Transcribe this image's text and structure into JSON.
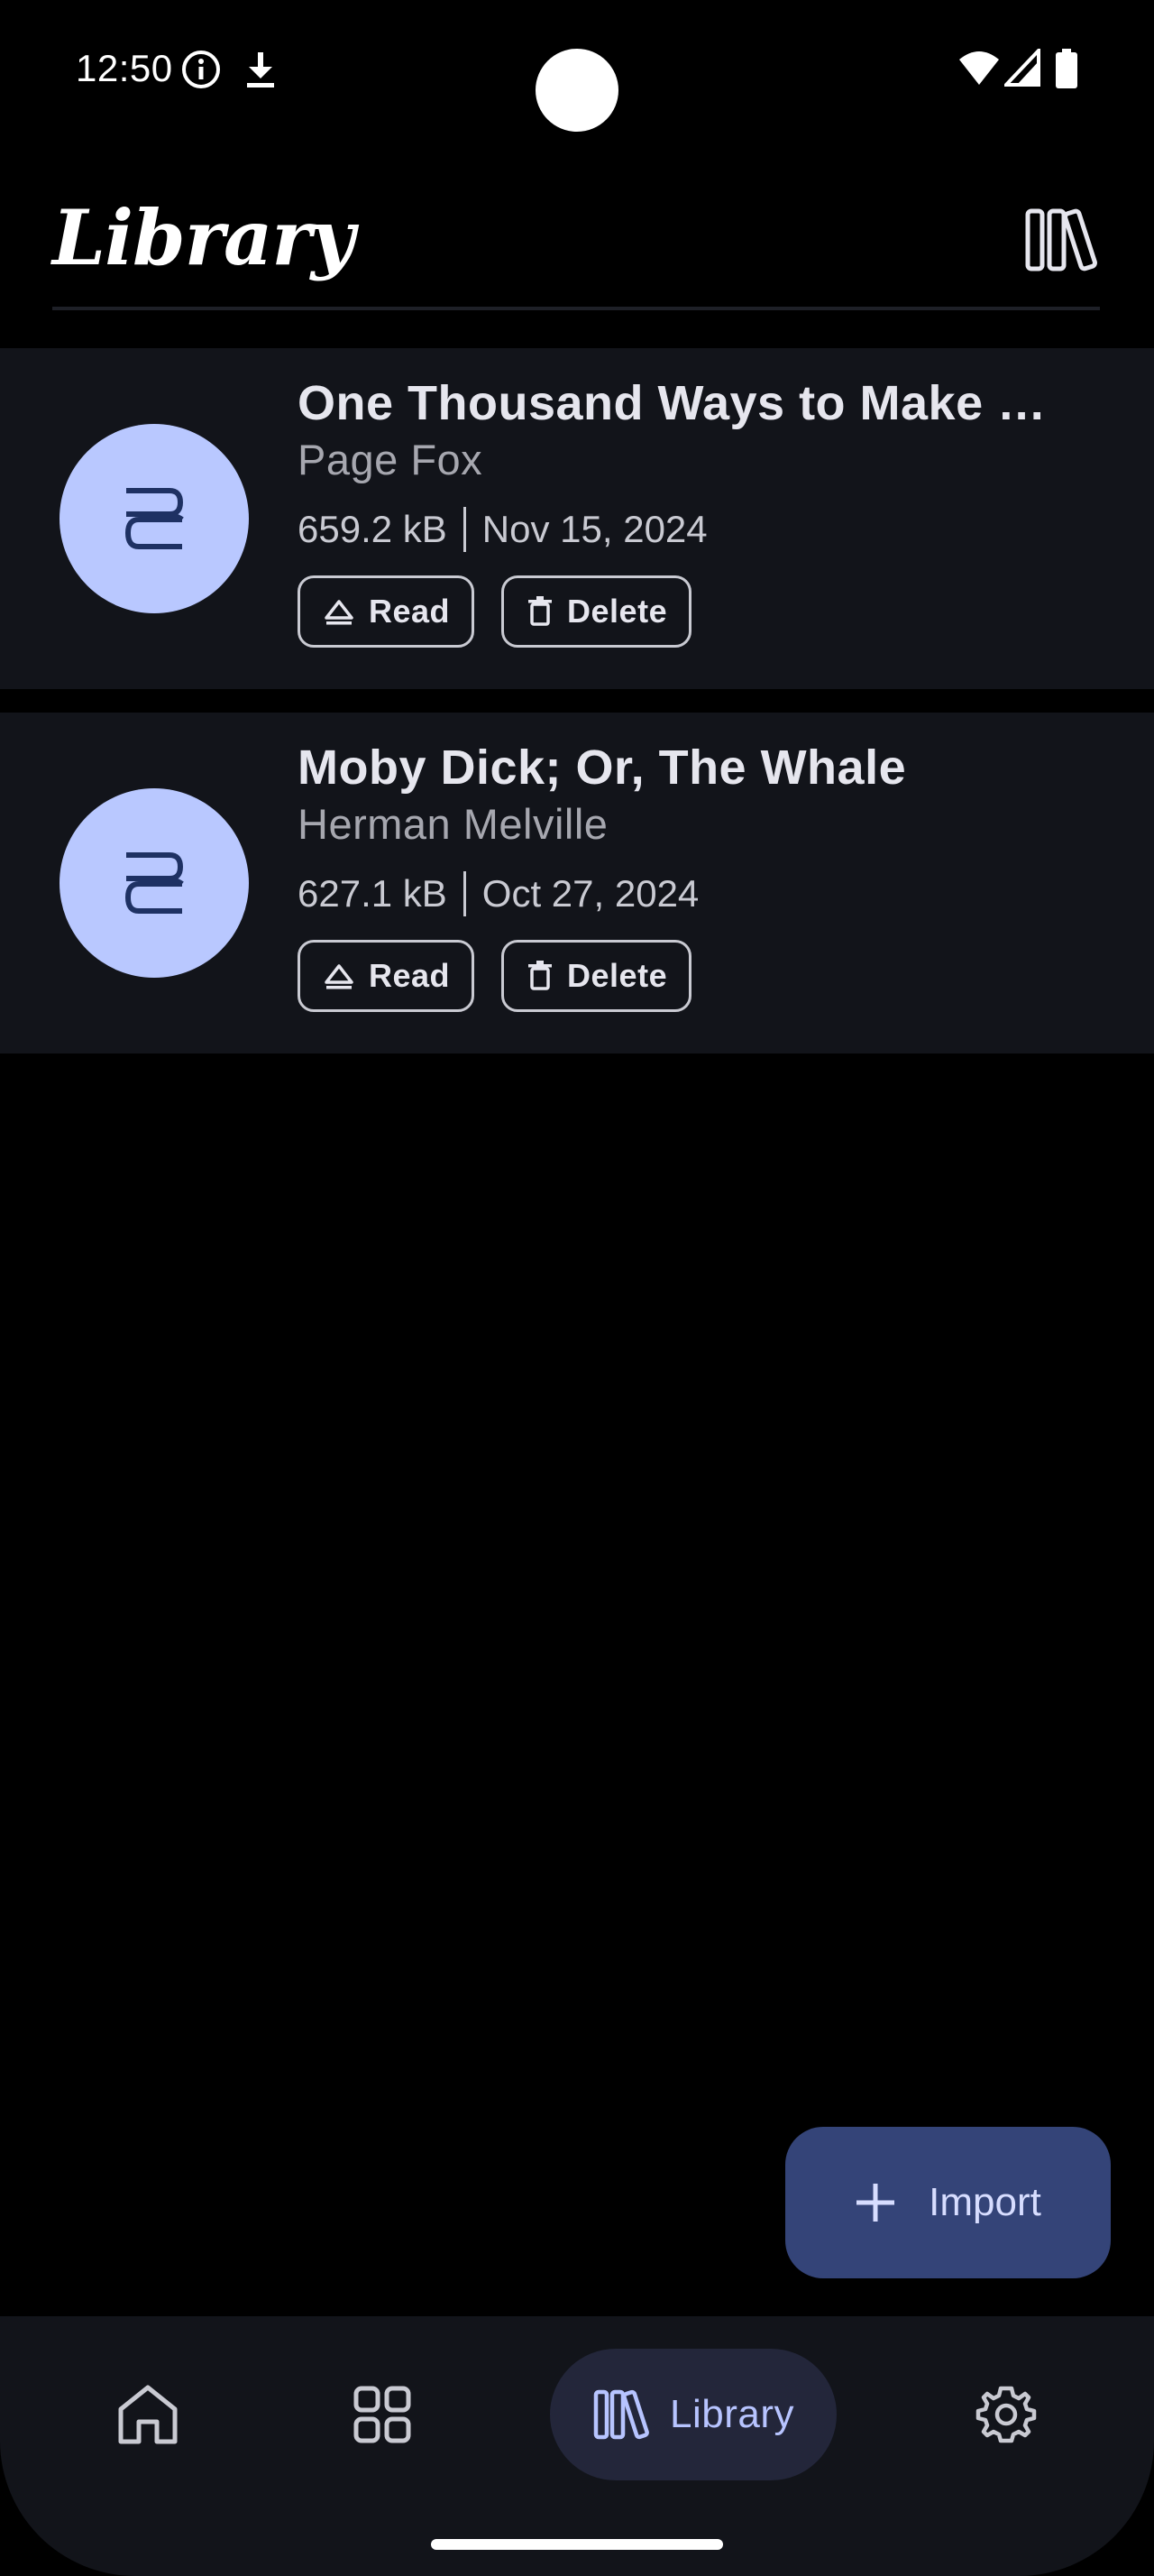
{
  "status_bar": {
    "time": "12:50",
    "icons": [
      "info-icon",
      "download-icon",
      "wifi-icon",
      "signal-icon",
      "battery-icon"
    ]
  },
  "header": {
    "title": "Library",
    "action_icon": "library-books-icon"
  },
  "books": [
    {
      "title": "One Thousand Ways to Make …",
      "author": "Page Fox",
      "size": "659.2 kB",
      "date": "Nov 15, 2024",
      "read_label": "Read",
      "delete_label": "Delete"
    },
    {
      "title": "Moby Dick; Or, The Whale",
      "author": "Herman Melville",
      "size": "627.1 kB",
      "date": "Oct 27, 2024",
      "read_label": "Read",
      "delete_label": "Delete"
    }
  ],
  "fab": {
    "label": "Import",
    "icon": "plus-icon"
  },
  "bottom_nav": {
    "items": [
      {
        "icon": "home-icon",
        "label": ""
      },
      {
        "icon": "grid-icon",
        "label": ""
      },
      {
        "icon": "library-icon",
        "label": "Library",
        "active": true
      },
      {
        "icon": "gear-icon",
        "label": ""
      }
    ]
  },
  "colors": {
    "background": "#000000",
    "card": "#12141a",
    "avatar": "#b9c8ff",
    "fab": "#344478",
    "nav_active": "#23263a",
    "accent": "#b7c4ff"
  }
}
